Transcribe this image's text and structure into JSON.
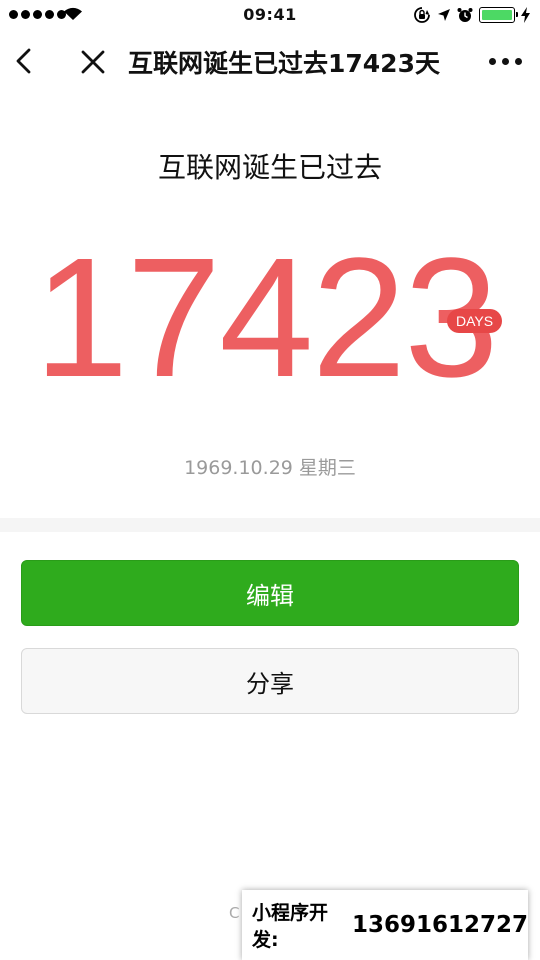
{
  "status_bar": {
    "time": "09:41",
    "battery_level": 1.0,
    "battery_color": "#4cd964",
    "icons": [
      "signal-dots",
      "wifi-icon",
      "orientation-lock-icon",
      "location-arrow-icon",
      "alarm-icon",
      "battery-icon",
      "charging-bolt-icon"
    ]
  },
  "nav": {
    "title": "互联网诞生已过去17423天",
    "back_icon": "chevron-left-icon",
    "close_icon": "close-icon",
    "more_icon": "more-dots-icon"
  },
  "main": {
    "headline": "互联网诞生已过去",
    "count": "17423",
    "unit_badge": "DAYS",
    "start_date": "1969.10.29 星期三",
    "accent_color": "#ed5f61"
  },
  "actions": {
    "edit_label": "编辑",
    "share_label": "分享",
    "edit_color": "#2fab1d"
  },
  "footer": {
    "partial_text": "C",
    "promo_label": "小程序开发:",
    "promo_phone": "13691612727"
  }
}
